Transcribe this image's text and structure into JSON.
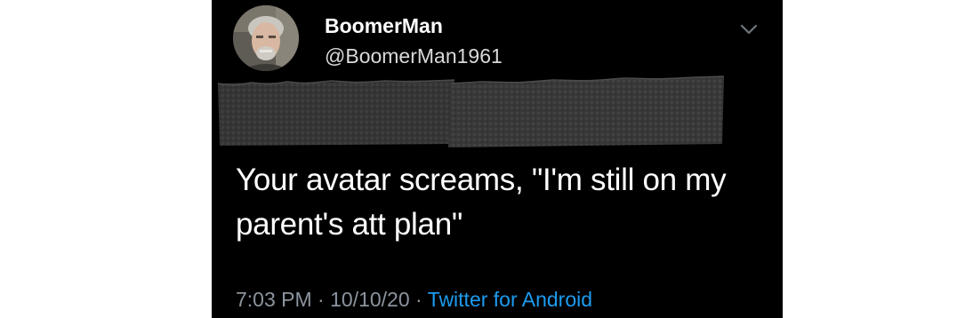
{
  "user": {
    "display_name": "BoomerMan",
    "handle": "@BoomerMan1961",
    "avatar_icon": "avatar-photo"
  },
  "tweet": {
    "text_lines": [
      "Your avatar screams, \"I'm still on my",
      "parent's att plan\""
    ]
  },
  "meta": {
    "time": "7:03 PM",
    "separator": " · ",
    "date": "10/10/20",
    "source": "Twitter for Android"
  },
  "icons": {
    "menu": "chevron-down-icon"
  },
  "colors": {
    "background": "#000000",
    "text": "#ffffff",
    "secondary": "#8b949e",
    "link": "#1d9bf0",
    "redaction_tape": "#3a3a3a"
  }
}
